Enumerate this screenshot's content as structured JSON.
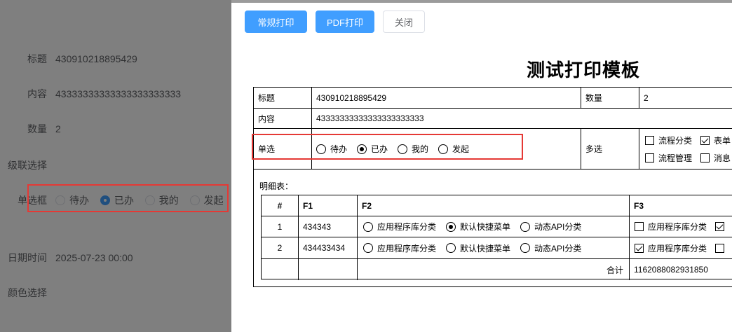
{
  "bg_form": {
    "title_label": "标题",
    "title_value": "430910218895429",
    "content_label": "内容",
    "content_value": "43333333333333333333333",
    "qty_label": "数量",
    "qty_value": "2",
    "cascade_label": "级联选择",
    "radio_label": "单选框",
    "radio_options": [
      "待办",
      "已办",
      "我的",
      "发起"
    ],
    "radio_selected": "已办",
    "datetime_label": "日期时间",
    "datetime_value": "2025-07-23 00:00",
    "color_label": "颜色选择"
  },
  "toolbar": {
    "normal_print": "常规打印",
    "pdf_print": "PDF打印",
    "close": "关闭"
  },
  "print": {
    "heading": "测试打印模板",
    "title_label": "标题",
    "title_value": "430910218895429",
    "qty_label": "数量",
    "qty_value": "2",
    "content_label": "内容",
    "content_value": "43333333333333333333333",
    "radio_label": "单选",
    "radio_options": [
      "待办",
      "已办",
      "我的",
      "发起"
    ],
    "radio_selected": "已办",
    "multi_label": "多选",
    "multi_options": [
      {
        "label": "流程分类",
        "checked": false
      },
      {
        "label": "表单",
        "checked": true
      },
      {
        "label": "流程管理",
        "checked": false
      },
      {
        "label": "消息",
        "checked": false
      }
    ],
    "detail_label": "明细表：",
    "detail": {
      "headers": [
        "#",
        "F1",
        "F2",
        "F3"
      ],
      "f2_options": [
        "应用程序库分类",
        "默认快捷菜单",
        "动态API分类"
      ],
      "rows": [
        {
          "idx": "1",
          "f1": "434343",
          "f2_selected": "默认快捷菜单",
          "f3": "应用程序库分类",
          "f3_checked": false,
          "f3_next_checked": true
        },
        {
          "idx": "2",
          "f1": "434433434",
          "f2_selected": "",
          "f3": "应用程序库分类",
          "f3_checked": true,
          "f3_next_checked": false
        }
      ],
      "total_label": "合计",
      "total_value": "1162088082931850"
    }
  }
}
